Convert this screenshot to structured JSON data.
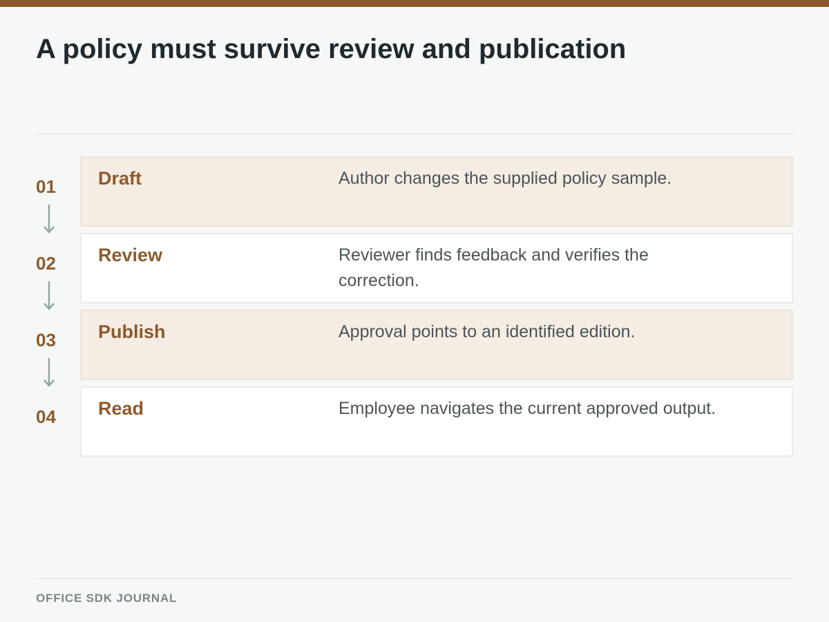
{
  "title": "A policy must survive review and publication",
  "footer": "OFFICE SDK JOURNAL",
  "colors": {
    "accent": "#8e5a2c",
    "arrow": "#8fa89e",
    "shaded_card": "#f5ece4",
    "plain_card": "#ffffff",
    "background": "#f6f8f7"
  },
  "steps": [
    {
      "number": "01",
      "name": "Draft",
      "description": "Author changes the supplied policy sample.",
      "shaded": true
    },
    {
      "number": "02",
      "name": "Review",
      "description": "Reviewer finds feedback and verifies the correction.",
      "shaded": false
    },
    {
      "number": "03",
      "name": "Publish",
      "description": "Approval points to an identified edition.",
      "shaded": true
    },
    {
      "number": "04",
      "name": "Read",
      "description": "Employee navigates the current approved output.",
      "shaded": false
    }
  ]
}
